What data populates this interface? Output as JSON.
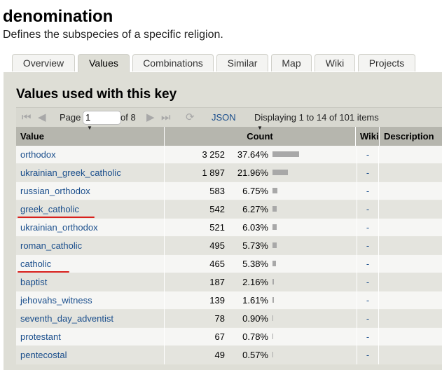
{
  "page": {
    "title": "denomination",
    "subtitle": "Defines the subspecies of a specific religion."
  },
  "tabs": [
    {
      "label": "Overview",
      "active": false
    },
    {
      "label": "Values",
      "active": true
    },
    {
      "label": "Combinations",
      "active": false
    },
    {
      "label": "Similar",
      "active": false
    },
    {
      "label": "Map",
      "active": false
    },
    {
      "label": "Wiki",
      "active": false
    },
    {
      "label": "Projects",
      "active": false
    }
  ],
  "panel": {
    "title": "Values used with this key"
  },
  "pager": {
    "page_label": "Page",
    "page_value": "1",
    "of_label": "of 8",
    "json_label": "JSON",
    "display_text": "Displaying 1 to 14 of 101 items"
  },
  "table": {
    "headers": {
      "value": "Value",
      "count": "Count",
      "wiki": "Wiki",
      "description": "Description"
    },
    "rows": [
      {
        "value": "orthodox",
        "count": "3 252",
        "percent": "37.64%",
        "fraction": 0.3764,
        "wiki": "-"
      },
      {
        "value": "ukrainian_greek_catholic",
        "count": "1 897",
        "percent": "21.96%",
        "fraction": 0.2196,
        "wiki": "-"
      },
      {
        "value": "russian_orthodox",
        "count": "583",
        "percent": "6.75%",
        "fraction": 0.0675,
        "wiki": "-"
      },
      {
        "value": "greek_catholic",
        "count": "542",
        "percent": "6.27%",
        "fraction": 0.0627,
        "wiki": "-"
      },
      {
        "value": "ukrainian_orthodox",
        "count": "521",
        "percent": "6.03%",
        "fraction": 0.0603,
        "wiki": "-"
      },
      {
        "value": "roman_catholic",
        "count": "495",
        "percent": "5.73%",
        "fraction": 0.0573,
        "wiki": "-"
      },
      {
        "value": "catholic",
        "count": "465",
        "percent": "5.38%",
        "fraction": 0.0538,
        "wiki": "-"
      },
      {
        "value": "baptist",
        "count": "187",
        "percent": "2.16%",
        "fraction": 0.0216,
        "wiki": "-"
      },
      {
        "value": "jehovahs_witness",
        "count": "139",
        "percent": "1.61%",
        "fraction": 0.0161,
        "wiki": "-"
      },
      {
        "value": "seventh_day_adventist",
        "count": "78",
        "percent": "0.90%",
        "fraction": 0.009,
        "wiki": "-"
      },
      {
        "value": "protestant",
        "count": "67",
        "percent": "0.78%",
        "fraction": 0.0078,
        "wiki": "-"
      },
      {
        "value": "pentecostal",
        "count": "49",
        "percent": "0.57%",
        "fraction": 0.0057,
        "wiki": "-"
      }
    ]
  },
  "colors": {
    "link": "#1a4e8c",
    "bar": "#a8a8a8",
    "annotation": "#d8201c"
  },
  "icons": [
    "first-page-icon",
    "prev-page-icon",
    "next-page-icon",
    "last-page-icon",
    "refresh-icon"
  ]
}
